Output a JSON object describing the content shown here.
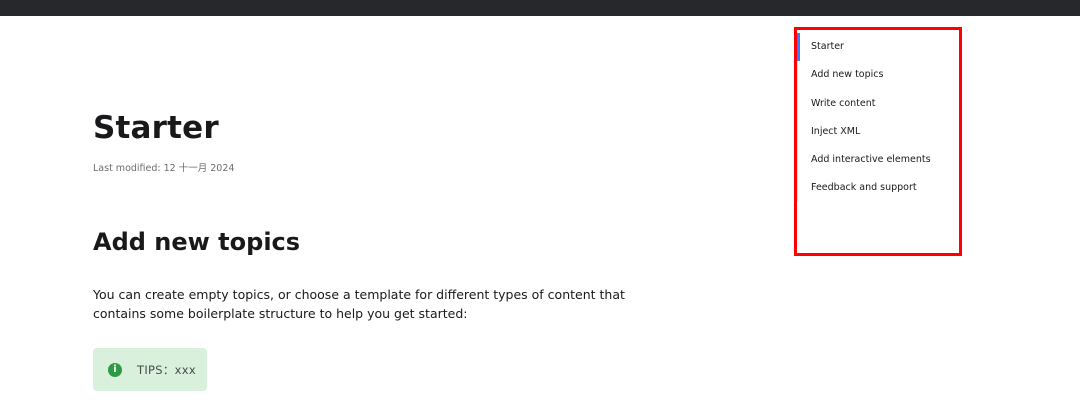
{
  "article": {
    "title": "Starter",
    "last_modified": "Last modified: 12 十一月 2024",
    "section_title": "Add new topics",
    "paragraph": "You can create empty topics, or choose a template for different types of content that contains some boilerplate structure to help you get started:",
    "tip": {
      "icon": "info-icon",
      "icon_glyph": "i",
      "text": "TIPS：xxx",
      "background": "#d8f0dc",
      "icon_color": "#2e9a44"
    }
  },
  "toc": {
    "active_index": 0,
    "accent_color": "#307fff",
    "highlight_color": "#ff0000",
    "items": [
      {
        "label": "Starter"
      },
      {
        "label": "Add new topics"
      },
      {
        "label": "Write content"
      },
      {
        "label": "Inject XML"
      },
      {
        "label": "Add interactive elements"
      },
      {
        "label": "Feedback and support"
      }
    ]
  }
}
